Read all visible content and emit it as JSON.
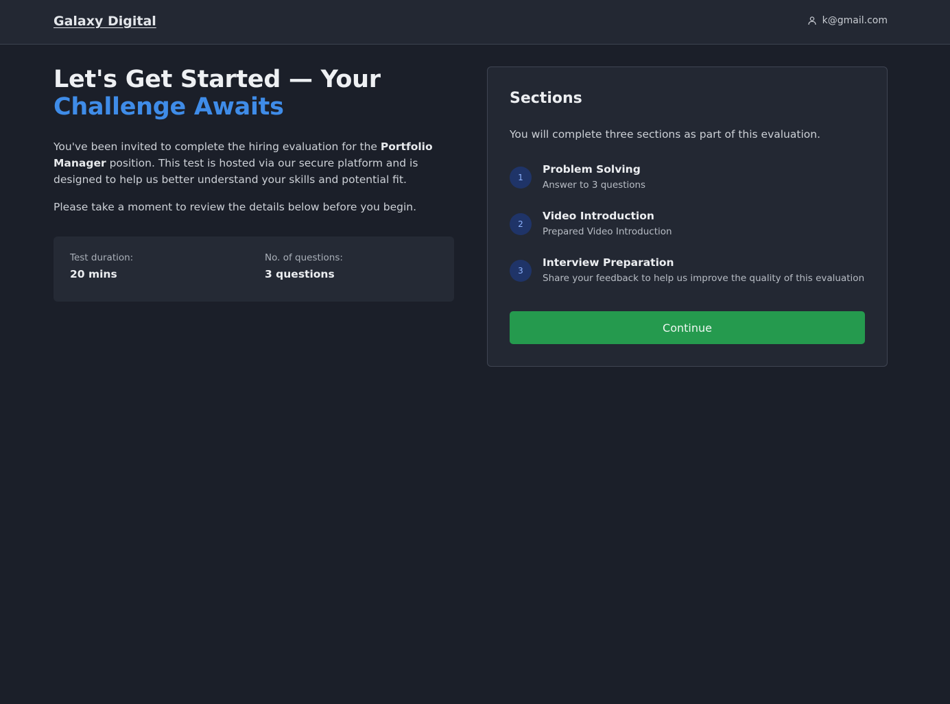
{
  "header": {
    "brand": "Galaxy Digital",
    "user_email": "k@gmail.com"
  },
  "hero": {
    "title_line1": "Let's Get Started — Your",
    "title_line2": "Challenge Awaits"
  },
  "intro": {
    "before_role": "You've been invited to complete the hiring evaluation for the ",
    "role": "Portfolio Manager",
    "after_role": " position. This test is hosted via our secure platform and is designed to help us better understand your skills and potential fit.",
    "review_note": "Please take a moment to review the details below before you begin."
  },
  "stats": {
    "duration_label": "Test duration:",
    "duration_value": "20 mins",
    "questions_label": "No. of questions:",
    "questions_value": "3 questions"
  },
  "sections_card": {
    "title": "Sections",
    "description": "You will complete three sections as part of this evaluation.",
    "items": [
      {
        "number": "1",
        "title": "Problem Solving",
        "subtitle": "Answer to 3 questions"
      },
      {
        "number": "2",
        "title": "Video Introduction",
        "subtitle": "Prepared Video Introduction"
      },
      {
        "number": "3",
        "title": "Interview Preparation",
        "subtitle": "Share your feedback to help us improve the quality of this evaluation"
      }
    ],
    "continue_label": "Continue"
  },
  "colors": {
    "background": "#1b1f29",
    "accent": "#3f8ce8",
    "button": "#259a4e"
  },
  "icons": {
    "user": "user-icon"
  }
}
